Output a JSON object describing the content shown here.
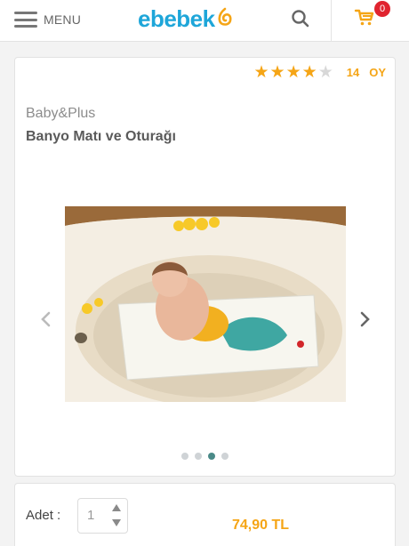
{
  "header": {
    "menu_label": "MENU",
    "logo_text": "ebebek",
    "cart_count": "0"
  },
  "product": {
    "rating": 4,
    "rating_max": 5,
    "review_count": "14",
    "review_word": "OY",
    "brand": "Baby&Plus",
    "title": "Banyo Matı ve Oturağı",
    "gallery_slides": 4,
    "active_slide": 3
  },
  "purchase": {
    "quantity_label": "Adet :",
    "quantity_value": "1",
    "price": "74,90 TL"
  },
  "colors": {
    "brand_blue": "#1ea6d9",
    "accent_orange": "#f5a516",
    "badge_red": "#e0242f",
    "active_dot": "#4a8a88"
  }
}
